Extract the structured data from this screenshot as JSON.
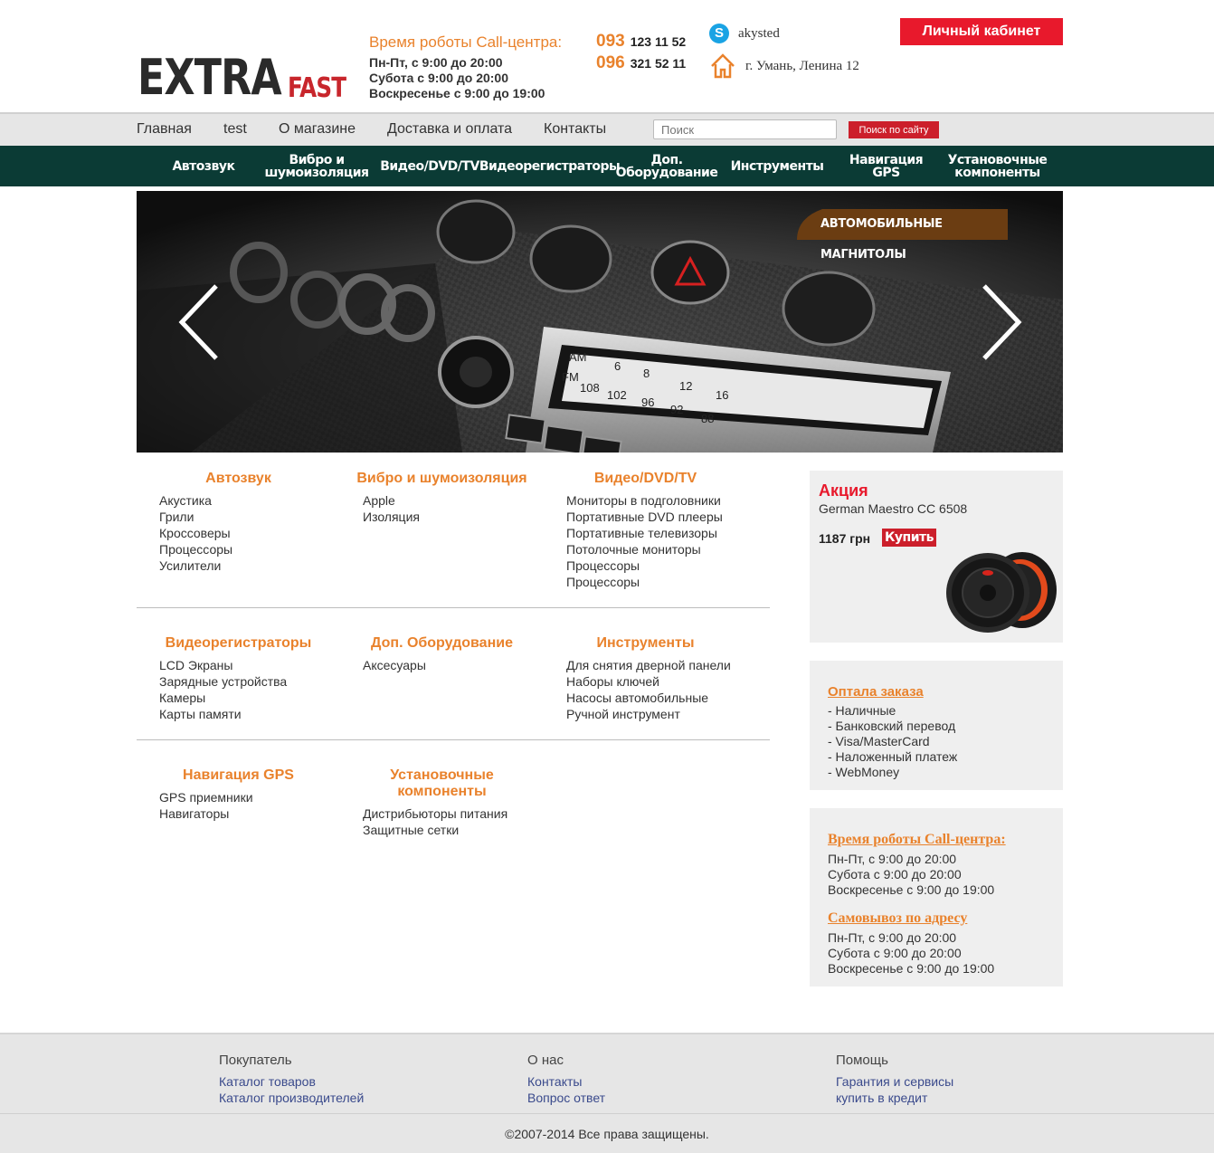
{
  "header": {
    "logo_main": "EXTRA",
    "logo_accent": "FAST",
    "hours_title": "Время роботы Call-центра:",
    "hours": [
      "Пн-Пт, с 9:00 до 20:00",
      "Субота с 9:00 до 20:00",
      "Воскресенье с 9:00 до 19:00"
    ],
    "phones": [
      {
        "code": "093",
        "number": "123 11 52"
      },
      {
        "code": "096",
        "number": "321 52 11"
      }
    ],
    "skype": "akysted",
    "address": "г. Умань, Ленина 12",
    "cabinet_label": "Личный кабинет"
  },
  "topnav": {
    "items": [
      "Главная",
      "test",
      "О магазине",
      "Доставка и оплата",
      "Контакты"
    ],
    "search_placeholder": "Поиск",
    "search_button": "Поиск по сайту"
  },
  "catbar": {
    "items": [
      "Автозвук",
      "Вибро и шумоизоляция",
      "Видео/DVD/TV",
      "Видеорегистраторы",
      "Доп. Оборудование",
      "Инструменты",
      "Навигация GPS",
      "Установочные компоненты"
    ]
  },
  "slider": {
    "badge": "АВТОМОБИЛЬНЫЕ МАГНИТОЛЫ",
    "dial_labels": [
      "AM",
      "FM",
      "6",
      "8",
      "12",
      "16",
      "108",
      "102",
      "96",
      "92",
      "88"
    ]
  },
  "catalog": [
    {
      "title": "Автозвук",
      "links": [
        "Акустика",
        "Грили",
        "Кроссоверы",
        "Процессоры",
        "Усилители"
      ]
    },
    {
      "title": "Вибро и шумоизоляция",
      "links": [
        "Apple",
        "Изоляция"
      ]
    },
    {
      "title": "Видео/DVD/TV",
      "links": [
        "Мониторы в подголовники",
        "Портативные DVD плееры",
        "Портативные телевизоры",
        "Потолочные мониторы",
        "Процессоры",
        "Процессоры"
      ]
    },
    {
      "title": "Видеорегистраторы",
      "links": [
        "LCD Экраны",
        "Зарядные устройства",
        "Камеры",
        "Карты памяти"
      ]
    },
    {
      "title": "Доп. Оборудование",
      "links": [
        "Аксесуары"
      ]
    },
    {
      "title": "Инструменты",
      "links": [
        "Для снятия дверной панели",
        "Наборы ключей",
        "Насосы автомобильные",
        "Ручной инструмент"
      ]
    },
    {
      "title": "Навигация GPS",
      "links": [
        "GPS приемники",
        "Навигаторы"
      ]
    },
    {
      "title": "Установочные компоненты",
      "links": [
        "Дистрибьюторы питания",
        "Защитные сетки"
      ]
    }
  ],
  "promo": {
    "title": "Акция",
    "product": "German Maestro CC 6508",
    "price": "1187 грн",
    "buy_label": "Купить"
  },
  "payment": {
    "title": "Оптала заказа",
    "items": [
      "- Наличные",
      "- Банковский перевод",
      "- Visa/MasterCard",
      "- Наложенный платеж",
      "- WebMoney"
    ]
  },
  "schedule": {
    "call_title": "Время роботы Call-центра:",
    "call_lines": [
      "Пн-Пт, с 9:00 до 20:00",
      "Субота с 9:00 до 20:00",
      "Воскресенье с 9:00 до 19:00"
    ],
    "pickup_title": "Самовывоз по адресу",
    "pickup_lines": [
      "Пн-Пт, с 9:00 до 20:00",
      "Субота с 9:00 до 20:00",
      "Воскресенье с 9:00 до 19:00"
    ]
  },
  "footer": {
    "columns": [
      {
        "head": "Покупатель",
        "links": [
          "Каталог товаров",
          "Каталог производителей"
        ]
      },
      {
        "head": "О нас",
        "links": [
          "Контакты",
          "Вопрос ответ"
        ]
      },
      {
        "head": "Помощь",
        "links": [
          "Гарантия и сервисы",
          "купить в кредит"
        ]
      }
    ],
    "copyright": "©2007-2014 Все права защищены."
  },
  "colors": {
    "accent_orange": "#e9822c",
    "accent_red": "#e8192c",
    "catbar_bg": "#0b3b35"
  },
  "icons": [
    "skype-icon",
    "home-icon",
    "chevron-left-icon",
    "chevron-right-icon"
  ]
}
